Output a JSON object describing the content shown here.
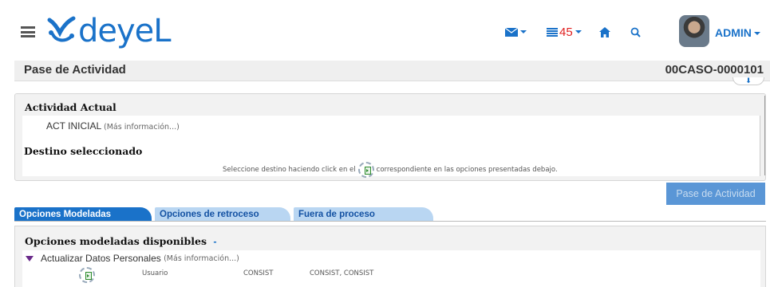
{
  "header": {
    "logo_text": "deyeL",
    "task_count": "45",
    "user": "ADMIN"
  },
  "icons": {
    "menu": "hamburger-icon",
    "mail": "envelope-icon",
    "tasks": "task-list-icon",
    "home": "home-icon",
    "search": "search-icon",
    "go": "select-destination-icon"
  },
  "page": {
    "title": "Pase de Actividad",
    "case_id": "00CASO-0000101"
  },
  "actividad": {
    "heading": "Actividad Actual",
    "current": "ACT INICIAL",
    "more": "(Más información...)",
    "destino_heading": "Destino seleccionado",
    "hint_before": "Seleccione destino haciendo click en el",
    "hint_after": "correspondiente en las opciones presentadas debajo."
  },
  "pase_button": "Pase de Actividad",
  "tabs": [
    {
      "label": "Opciones Modeladas",
      "active": true
    },
    {
      "label": "Opciones de retroceso",
      "active": false
    },
    {
      "label": "Fuera de proceso",
      "active": false
    }
  ],
  "opciones": {
    "heading": "Opciones modeladas disponibles",
    "toggle": "-",
    "items": [
      {
        "name": "Actualizar Datos Personales",
        "more": "(Más información...)",
        "role": "Usuario",
        "group": "CONSIST",
        "users": "CONSIST, CONSIST"
      }
    ]
  },
  "colors": {
    "brand_blue": "#1a72c9",
    "task_count_red": "#e02020",
    "button_bg": "#5a96d6"
  }
}
